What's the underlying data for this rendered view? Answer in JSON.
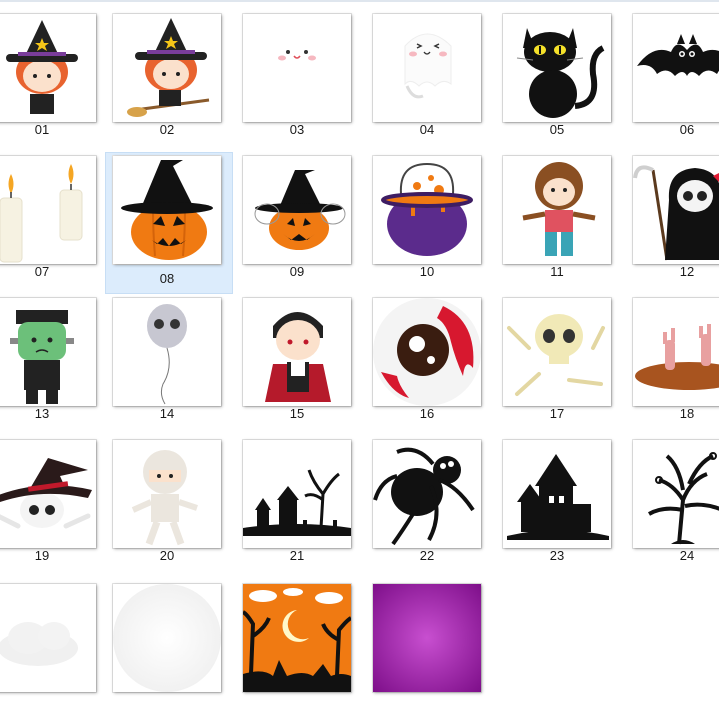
{
  "files": [
    {
      "label": "01",
      "icon": "witch-girl-icon"
    },
    {
      "label": "02",
      "icon": "witch-on-broom-icon"
    },
    {
      "label": "03",
      "icon": "cute-face-icon"
    },
    {
      "label": "04",
      "icon": "cute-ghost-icon"
    },
    {
      "label": "05",
      "icon": "black-cat-icon"
    },
    {
      "label": "06",
      "icon": "bat-icon"
    },
    {
      "label": "07",
      "icon": "candles-icon"
    },
    {
      "label": "08",
      "icon": "pumpkin-witch-hat-icon"
    },
    {
      "label": "09",
      "icon": "pumpkin-hat-spiders-icon"
    },
    {
      "label": "10",
      "icon": "cauldron-icon"
    },
    {
      "label": "11",
      "icon": "werewolf-kid-icon"
    },
    {
      "label": "12",
      "icon": "grim-reaper-icon"
    },
    {
      "label": "13",
      "icon": "frankenstein-icon"
    },
    {
      "label": "14",
      "icon": "skull-balloon-icon"
    },
    {
      "label": "15",
      "icon": "vampire-icon"
    },
    {
      "label": "16",
      "icon": "bloody-eyeball-icon"
    },
    {
      "label": "17",
      "icon": "skull-bones-icon"
    },
    {
      "label": "18",
      "icon": "zombie-hands-icon"
    },
    {
      "label": "19",
      "icon": "skull-witch-hat-icon"
    },
    {
      "label": "20",
      "icon": "mummy-icon"
    },
    {
      "label": "21",
      "icon": "haunted-town-silhouette-icon"
    },
    {
      "label": "22",
      "icon": "spider-icon"
    },
    {
      "label": "23",
      "icon": "haunted-house-icon"
    },
    {
      "label": "24",
      "icon": "spooky-tree-icon"
    },
    {
      "label": "",
      "icon": "cloud-icon"
    },
    {
      "label": "",
      "icon": "white-glow-icon"
    },
    {
      "label": "",
      "icon": "halloween-night-background-icon"
    },
    {
      "label": "",
      "icon": "purple-background-icon"
    }
  ],
  "selected_label": "08",
  "colors": {
    "selection": "#dcecfc",
    "pumpkin": "#f07a12",
    "purple": "#8e1a96"
  }
}
